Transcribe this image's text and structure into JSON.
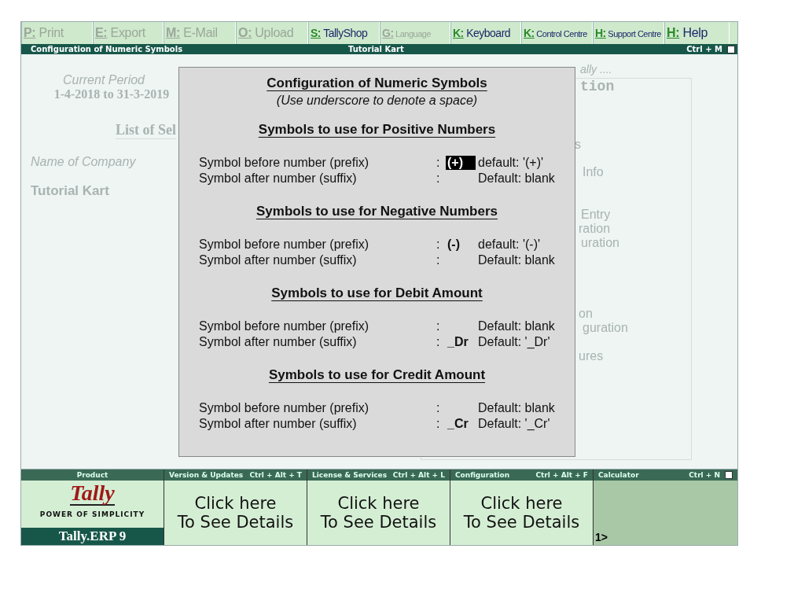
{
  "menu": [
    {
      "key": "P:",
      "label": "Print",
      "disabled": true
    },
    {
      "key": "E:",
      "label": "Export",
      "disabled": true
    },
    {
      "key": "M:",
      "label": "E-Mail",
      "disabled": true
    },
    {
      "key": "O:",
      "label": "Upload",
      "disabled": true
    },
    {
      "key": "S:",
      "label": "TallyShop",
      "disabled": false
    },
    {
      "key": "G:",
      "label": "Language",
      "disabled": true
    },
    {
      "key": "K:",
      "label": "Keyboard",
      "disabled": false
    },
    {
      "key": "K:",
      "label": "Control Centre",
      "disabled": false
    },
    {
      "key": "H:",
      "label": "Support Centre",
      "disabled": false
    },
    {
      "key": "H:",
      "label": "Help",
      "disabled": false
    }
  ],
  "title_bar": {
    "title": "Configuration of Numeric Symbols",
    "company": "Tutorial Kart",
    "shortcut": "Ctrl + M"
  },
  "background": {
    "period_label": "Current Period",
    "period": "1-4-2018 to 31-3-2019",
    "list_heading": "List of Sel",
    "company_label": "Name of Company",
    "company_name": "Tutorial Kart",
    "right_fragments": [
      "ally ....",
      "tion",
      "s",
      "Info",
      "Entry",
      "ration",
      "uration",
      "on",
      "guration",
      "ures"
    ]
  },
  "dialog": {
    "title": "Configuration of Numeric Symbols",
    "subtitle": "(Use underscore to denote a space)",
    "sections": [
      {
        "heading": "Symbols to use for Positive Numbers",
        "rows": [
          {
            "label": "Symbol before number (prefix)",
            "separator": ":",
            "value": "(+)",
            "focused": true,
            "default": "default: '(+)'"
          },
          {
            "label": "Symbol after number (suffix)",
            "separator": ":",
            "value": "",
            "focused": false,
            "default": "Default: blank"
          }
        ]
      },
      {
        "heading": "Symbols to use for Negative Numbers",
        "rows": [
          {
            "label": "Symbol before number (prefix)",
            "separator": ":",
            "value": "(-)",
            "focused": false,
            "default": "default: '(-)'"
          },
          {
            "label": "Symbol after number (suffix)",
            "separator": ":",
            "value": "",
            "focused": false,
            "default": "Default: blank"
          }
        ]
      },
      {
        "heading": "Symbols to use for Debit Amount",
        "rows": [
          {
            "label": "Symbol before number (prefix)",
            "separator": ":",
            "value": "",
            "focused": false,
            "default": "Default: blank"
          },
          {
            "label": "Symbol after number (suffix)",
            "separator": ":",
            "value": "_Dr",
            "focused": false,
            "default": "Default: '_Dr'"
          }
        ]
      },
      {
        "heading": "Symbols to use for Credit Amount",
        "rows": [
          {
            "label": "Symbol before number (prefix)",
            "separator": ":",
            "value": "",
            "focused": false,
            "default": "Default: blank"
          },
          {
            "label": "Symbol after number (suffix)",
            "separator": ":",
            "value": "_Cr",
            "focused": false,
            "default": "Default: '_Cr'"
          }
        ]
      }
    ]
  },
  "bottom": {
    "product": {
      "title": "Product",
      "logo": "Tally",
      "tagline": "POWER OF SIMPLICITY",
      "name": "Tally.ERP 9"
    },
    "panels": [
      {
        "title": "Version & Updates",
        "shortcut": "Ctrl + Alt + T",
        "line1": "Click here",
        "line2": "To See Details"
      },
      {
        "title": "License & Services",
        "shortcut": "Ctrl + Alt + L",
        "line1": "Click here",
        "line2": "To See Details"
      },
      {
        "title": "Configuration",
        "shortcut": "Ctrl + Alt + F",
        "line1": "Click here",
        "line2": "To See Details"
      }
    ],
    "calculator": {
      "title": "Calculator",
      "shortcut": "Ctrl + N",
      "prompt": "1>"
    }
  }
}
